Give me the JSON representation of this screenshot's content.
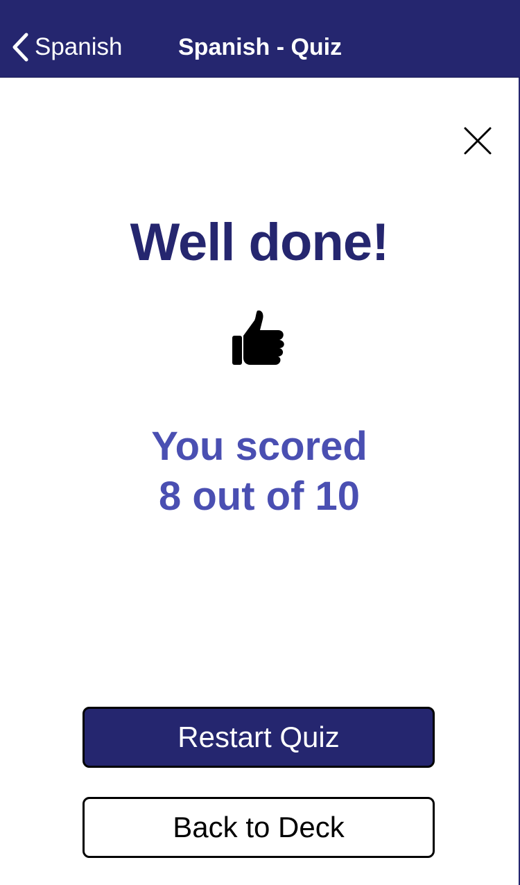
{
  "nav": {
    "back_label": "Spanish",
    "title": "Spanish - Quiz"
  },
  "result": {
    "headline": "Well done!",
    "icon": "thumbs-up-icon",
    "score_line1": "You scored",
    "score_line2": "8 out of 10"
  },
  "actions": {
    "restart_label": "Restart Quiz",
    "back_to_deck_label": "Back to Deck"
  },
  "colors": {
    "nav_background": "#25266f",
    "headline": "#25266f",
    "score_text": "#4a4fb2",
    "primary_button": "#25266f"
  }
}
